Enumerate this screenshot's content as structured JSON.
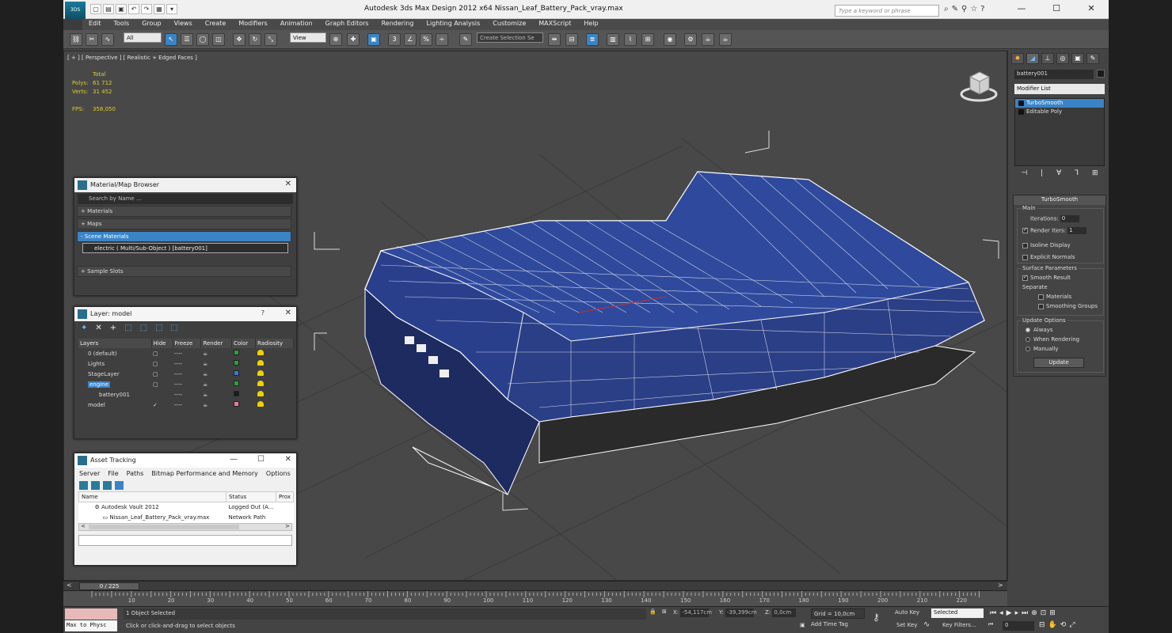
{
  "window": {
    "title": "Autodesk 3ds Max Design 2012 x64      Nissan_Leaf_Battery_Pack_vray.max",
    "app_icon_label": "3DS",
    "search_placeholder": "Type a keyword or phrase",
    "minimize": "—",
    "maximize": "☐",
    "close": "✕"
  },
  "menu": {
    "items": [
      "Edit",
      "Tools",
      "Group",
      "Views",
      "Create",
      "Modifiers",
      "Animation",
      "Graph Editors",
      "Rendering",
      "Lighting Analysis",
      "Customize",
      "MAXScript",
      "Help"
    ]
  },
  "toolbar": {
    "selection_filter": "All",
    "ref_coord": "View",
    "named_selection": "Create Selection Se"
  },
  "viewport": {
    "label": "[ + ] [ Perspective ] [ Realistic + Edged Faces ]",
    "stats_header": "Total",
    "polys_label": "Polys:",
    "polys_value": "61 712",
    "verts_label": "Verts:",
    "verts_value": "31 452",
    "fps_label": "FPS:",
    "fps_value": "358,050",
    "viewcube_label": "FRONT"
  },
  "material_browser": {
    "title": "Material/Map Browser",
    "search_placeholder": "Search by Name ...",
    "sections": [
      "+ Materials",
      "+ Maps",
      "- Scene Materials"
    ],
    "scene_material": "electric  ( Multi/Sub-Object )  [battery001]",
    "sample_slots": "+ Sample Slots"
  },
  "layer_manager": {
    "title": "Layer: model",
    "help": "?",
    "columns": [
      "Layers",
      "Hide",
      "Freeze",
      "Render",
      "Color",
      "Radiosity"
    ],
    "rows": [
      {
        "name": "0 (default)",
        "hide": "▢",
        "freeze": "----",
        "render": "☕",
        "color": "#2e9c3a"
      },
      {
        "name": "Lights",
        "hide": "▢",
        "freeze": "----",
        "render": "☕",
        "color": "#2e9c3a"
      },
      {
        "name": "StageLayer",
        "hide": "▢",
        "freeze": "----",
        "render": "☕",
        "color": "#3a78d8"
      },
      {
        "name": "engine",
        "hide": "▢",
        "freeze": "----",
        "render": "☕",
        "color": "#2e9c3a"
      },
      {
        "name": "battery001",
        "hide": "",
        "freeze": "----",
        "render": "☕",
        "color": "#1b1b1b"
      },
      {
        "name": "model",
        "hide": "✓",
        "freeze": "----",
        "render": "☕",
        "color": "#e87aa0"
      }
    ]
  },
  "asset_tracking": {
    "title": "Asset Tracking",
    "menu": [
      "Server",
      "File",
      "Paths",
      "Bitmap Performance and Memory",
      "Options"
    ],
    "columns": [
      "Name",
      "Status",
      "Prox"
    ],
    "rows": [
      {
        "name": "Autodesk Vault 2012",
        "status": "Logged Out (A..."
      },
      {
        "name": "Nissan_Leaf_Battery_Pack_vray.max",
        "status": "Network Path"
      }
    ],
    "scroll_left": "<",
    "scroll_right": ">"
  },
  "command_panel": {
    "object_name": "battery001",
    "modifier_list": "Modifier List",
    "stack": [
      "TurboSmooth",
      "Editable Poly"
    ],
    "rollout_title": "TurboSmooth",
    "main_group": "Main",
    "iterations_label": "Iterations:",
    "iterations_value": "0",
    "render_iters_label": "Render Iters:",
    "render_iters_value": "1",
    "isoline": "Isoline Display",
    "explicit_normals": "Explicit Normals",
    "surface_group": "Surface Parameters",
    "smooth_result": "Smooth Result",
    "separate": "Separate",
    "materials": "Materials",
    "smoothing_groups": "Smoothing Groups",
    "update_group": "Update Options",
    "always": "Always",
    "when_rendering": "When Rendering",
    "manually": "Manually",
    "update_button": "Update"
  },
  "timeline": {
    "slider": "0 / 225",
    "ticks": [
      "10",
      "20",
      "30",
      "40",
      "50",
      "60",
      "70",
      "80",
      "90",
      "100",
      "110",
      "120",
      "130",
      "140",
      "150",
      "160",
      "170",
      "180",
      "190",
      "200",
      "210",
      "220"
    ]
  },
  "statusbar": {
    "maxscript": "Max to Physc",
    "selection": "1 Object Selected",
    "prompt": "Click or click-and-drag to select objects",
    "x_label": "X:",
    "x_value": "-54,117cm",
    "y_label": "Y:",
    "y_value": "-39,399cm",
    "z_label": "Z:",
    "z_value": "0,0cm",
    "grid": "Grid = 10,0cm",
    "add_time_tag": "Add Time Tag",
    "auto_key": "Auto Key",
    "selected": "Selected",
    "set_key": "Set Key",
    "key_filters": "Key Filters...",
    "frame": "0"
  }
}
